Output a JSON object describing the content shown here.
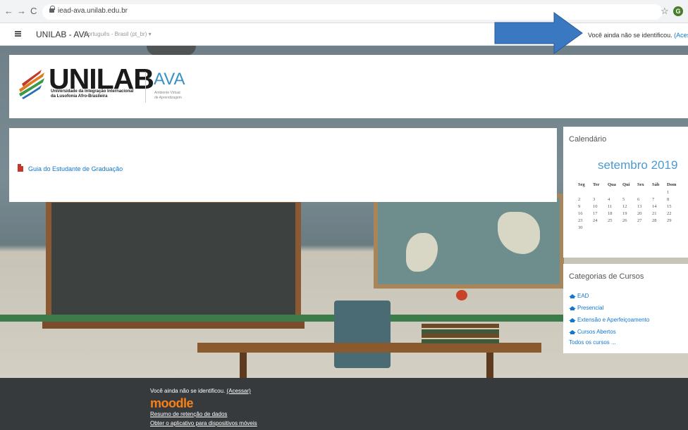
{
  "browser": {
    "back": "←",
    "forward": "→",
    "reload": "C",
    "url": "iead-ava.unilab.edu.br",
    "bookmark": "☆",
    "profile_initial": "G"
  },
  "navbar": {
    "brand": "UNILAB - AVA",
    "language": "Português - Brasil (pt_br) ▾",
    "login_text": "Você ainda não se identificou.",
    "login_link": "(Acessar)"
  },
  "header": {
    "logo_name": "UNILAB",
    "logo_sub1": "Universidade da Integração Internacional",
    "logo_sub2": "da Lusofonia Afro-Brasileira",
    "ava_name": "AVA",
    "ava_sub1": "Ambiente Virtual",
    "ava_sub2": "de Aprendizagem"
  },
  "main": {
    "guide_link": "Guia do Estudante de Graduação"
  },
  "calendar": {
    "title": "Calendário",
    "month": "setembro 2019",
    "weekdays": [
      "Seg",
      "Ter",
      "Qua",
      "Qui",
      "Sex",
      "Sáb",
      "Dom"
    ],
    "weeks": [
      [
        "",
        "",
        "",
        "",
        "",
        "",
        "1"
      ],
      [
        "2",
        "3",
        "4",
        "5",
        "6",
        "7",
        "8"
      ],
      [
        "9",
        "10",
        "11",
        "12",
        "13",
        "14",
        "15"
      ],
      [
        "16",
        "17",
        "18",
        "19",
        "20",
        "21",
        "22"
      ],
      [
        "23",
        "24",
        "25",
        "26",
        "27",
        "28",
        "29"
      ],
      [
        "30",
        "",
        "",
        "",
        "",
        "",
        ""
      ]
    ]
  },
  "categories": {
    "title": "Categorias de Cursos",
    "items": [
      "EAD",
      "Presencial",
      "Extensão e Aperfeiçoamento",
      "Cursos Abertos"
    ],
    "all_link": "Todos os cursos ..."
  },
  "footer": {
    "login_text": "Você ainda não se identificou.",
    "login_link": "(Acessar)",
    "moodle": "moodle",
    "data_retention": "Resumo de retenção de dados",
    "mobile_app": "Obter o aplicativo para dispositivos móveis"
  },
  "colors": {
    "link": "#1177d1",
    "arrow": "#3a78c2",
    "moodle_orange": "#f98012",
    "footer_bg": "#373a3c"
  }
}
